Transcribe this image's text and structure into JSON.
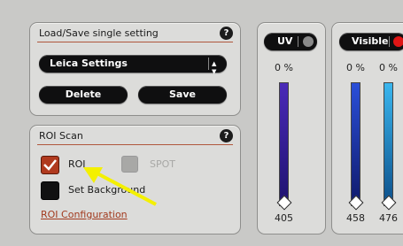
{
  "load_save": {
    "title": "Load/Save single setting",
    "select_value": "Leica Settings",
    "delete_label": "Delete",
    "save_label": "Save",
    "help_label": "?"
  },
  "roi_scan": {
    "title": "ROI Scan",
    "help_label": "?",
    "roi_label": "ROI",
    "spot_label": "SPOT",
    "set_background_label": "Set Background",
    "config_link": "ROI Configuration"
  },
  "channels": [
    {
      "label": "UV",
      "percent": "0 %",
      "value": "405",
      "bar_color": "#2a1a9c"
    },
    {
      "label": "Visible",
      "percent": "0 %",
      "value": "458",
      "bar_color": "#1c2fb8"
    },
    {
      "label": "",
      "percent": "0 %",
      "value": "476",
      "bar_color": "#1a9ed6"
    }
  ],
  "colors": {
    "accent_rule": "#b0573d",
    "check_active": "#b03a1e",
    "visible_toggle": "#e01515",
    "arrow": "#f4f000"
  }
}
